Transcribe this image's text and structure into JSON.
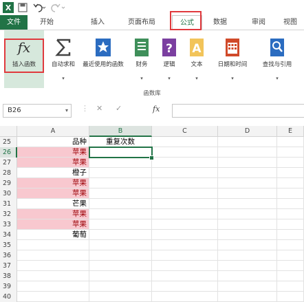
{
  "tabs": {
    "file": "文件",
    "items": [
      "开始",
      "插入",
      "页面布局",
      "公式",
      "数据",
      "审阅",
      "视图"
    ],
    "active": "公式"
  },
  "ribbon": {
    "insert_function": "插入函数",
    "buttons": [
      {
        "label": "自动求和",
        "icon": "sigma-icon",
        "color": "#444444"
      },
      {
        "label": "最近使用的函数",
        "icon": "star-icon",
        "color": "#2b6cc0"
      },
      {
        "label": "财务",
        "icon": "book-icon",
        "color": "#3f8f5a"
      },
      {
        "label": "逻辑",
        "icon": "question-icon",
        "color": "#7b3fa0"
      },
      {
        "label": "文本",
        "icon": "text-icon",
        "color": "#e0a83a"
      },
      {
        "label": "日期和时间",
        "icon": "calendar-icon",
        "color": "#d04a2a"
      },
      {
        "label": "查找与引用",
        "icon": "search-icon",
        "color": "#2b6cc0"
      }
    ],
    "group_label": "函数库"
  },
  "formula_bar": {
    "name_box": "B26",
    "fx": "fx",
    "formula": ""
  },
  "grid": {
    "columns": [
      "A",
      "B",
      "C",
      "D",
      "E"
    ],
    "selected_column": "B",
    "selected_row": 26,
    "rows": [
      {
        "num": "25",
        "a": "品种",
        "b": "重复次数",
        "dup": false
      },
      {
        "num": "26",
        "a": "苹果",
        "b": "",
        "dup": true
      },
      {
        "num": "27",
        "a": "苹果",
        "b": "",
        "dup": true
      },
      {
        "num": "28",
        "a": "橙子",
        "b": "",
        "dup": false
      },
      {
        "num": "29",
        "a": "苹果",
        "b": "",
        "dup": true
      },
      {
        "num": "30",
        "a": "苹果",
        "b": "",
        "dup": true
      },
      {
        "num": "31",
        "a": "芒果",
        "b": "",
        "dup": false
      },
      {
        "num": "32",
        "a": "苹果",
        "b": "",
        "dup": true
      },
      {
        "num": "33",
        "a": "苹果",
        "b": "",
        "dup": true
      },
      {
        "num": "34",
        "a": "葡萄",
        "b": "",
        "dup": false
      },
      {
        "num": "35",
        "a": "",
        "b": "",
        "dup": false
      },
      {
        "num": "36",
        "a": "",
        "b": "",
        "dup": false
      },
      {
        "num": "37",
        "a": "",
        "b": "",
        "dup": false
      },
      {
        "num": "38",
        "a": "",
        "b": "",
        "dup": false
      },
      {
        "num": "39",
        "a": "",
        "b": "",
        "dup": false
      },
      {
        "num": "40",
        "a": "",
        "b": "",
        "dup": false
      }
    ]
  },
  "colors": {
    "accent": "#217346",
    "highlight": "#e0393d",
    "dup_fill": "#f8c8cf",
    "dup_text": "#9c0006"
  }
}
